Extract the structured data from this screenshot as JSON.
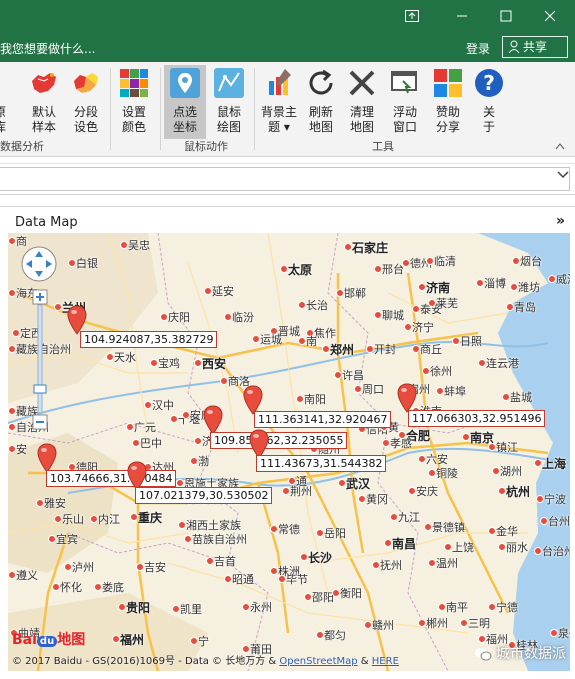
{
  "window": {
    "controls": [
      "ribbon-display-icon",
      "minimize-icon",
      "maximize-icon",
      "close-icon"
    ]
  },
  "tellbar": {
    "tell_text": "我您想要做什么...",
    "login": "登录",
    "share": "共享"
  },
  "ribbon": {
    "buttons": [
      {
        "label1": "数据分析",
        "label2": ""
      },
      {
        "label1": "默认",
        "label2": "样本"
      },
      {
        "label1": "分段",
        "label2": "设色"
      },
      {
        "label1": "设置",
        "label2": "颜色"
      },
      {
        "label1": "点选",
        "label2": "坐标"
      },
      {
        "label1": "鼠标",
        "label2": "绘图"
      },
      {
        "label1": "背景主",
        "label2": "题 ▾"
      },
      {
        "label1": "刷新",
        "label2": "地图"
      },
      {
        "label1": "清理",
        "label2": "地图"
      },
      {
        "label1": "浮动",
        "label2": "窗口"
      },
      {
        "label1": "赞助",
        "label2": "分享"
      },
      {
        "label1": "关",
        "label2": "于"
      }
    ],
    "groups": [
      "数据分析",
      "鼠标动作",
      "工具"
    ],
    "left_edge_chars": [
      "原",
      "库"
    ]
  },
  "panel": {
    "title": "Data Map",
    "expand_glyph": "»"
  },
  "map": {
    "cities": [
      [
        "吴忠",
        false
      ],
      [
        "太原",
        true
      ],
      [
        "石家庄",
        true
      ],
      [
        "德州",
        false
      ],
      [
        "烟台",
        false
      ],
      [
        "白银",
        false
      ],
      [
        "邢台",
        false
      ],
      [
        "临清",
        false
      ],
      [
        "威海",
        false
      ],
      [
        "海东",
        false
      ],
      [
        "兰州",
        true
      ],
      [
        "延安",
        false
      ],
      [
        "邯郸",
        false
      ],
      [
        "济南",
        true
      ],
      [
        "淄博",
        false
      ],
      [
        "潍坊",
        false
      ],
      [
        "庆阳",
        false
      ],
      [
        "长治",
        false
      ],
      [
        "临汾",
        false
      ],
      [
        "聊城",
        false
      ],
      [
        "泰安",
        false
      ],
      [
        "莱芜",
        false
      ],
      [
        "青岛",
        false
      ],
      [
        "定西",
        false
      ],
      [
        "晋城",
        false
      ],
      [
        "焦作",
        false
      ],
      [
        "运城",
        false
      ],
      [
        "济宁",
        false
      ],
      [
        "日照",
        false
      ],
      [
        "藏族自治州",
        false
      ],
      [
        "天水",
        false
      ],
      [
        "宝鸡",
        false
      ],
      [
        "西安",
        true
      ],
      [
        "郑州",
        true
      ],
      [
        "开封",
        false
      ],
      [
        "商丘",
        false
      ],
      [
        "徐州",
        false
      ],
      [
        "连云港",
        false
      ],
      [
        "商洛",
        false
      ],
      [
        "许昌",
        false
      ],
      [
        "周口",
        false
      ],
      [
        "宿州",
        false
      ],
      [
        "汉中",
        false
      ],
      [
        "十堰",
        false
      ],
      [
        "南阳",
        false
      ],
      [
        "驻马店",
        false
      ],
      [
        "蚌埠",
        false
      ],
      [
        "盐城",
        false
      ],
      [
        "藏族",
        false
      ],
      [
        "自治州",
        false
      ],
      [
        "广元",
        false
      ],
      [
        "安康",
        false
      ],
      [
        "信阳",
        false
      ],
      [
        "淮南",
        false
      ],
      [
        "合肥",
        true
      ],
      [
        "南京",
        true
      ],
      [
        "巴中",
        false
      ],
      [
        "达州",
        false
      ],
      [
        "随州",
        false
      ],
      [
        "孝感",
        false
      ],
      [
        "六安",
        false
      ],
      [
        "镇江",
        false
      ],
      [
        "德阳",
        false
      ],
      [
        "恩施土家族",
        false
      ],
      [
        "铜陵",
        false
      ],
      [
        "湖州",
        false
      ],
      [
        "上海",
        true
      ],
      [
        "雅安",
        false
      ],
      [
        "乐山",
        false
      ],
      [
        "内江",
        false
      ],
      [
        "重庆",
        true
      ],
      [
        "苗族自治州",
        false
      ],
      [
        "荆州",
        false
      ],
      [
        "武汉",
        true
      ],
      [
        "黄冈",
        false
      ],
      [
        "安庆",
        false
      ],
      [
        "杭州",
        true
      ],
      [
        "宁波",
        false
      ],
      [
        "宜宾",
        false
      ],
      [
        "泸州",
        false
      ],
      [
        "湘西土家族",
        false
      ],
      [
        "常德",
        false
      ],
      [
        "岳阳",
        false
      ],
      [
        "九江",
        false
      ],
      [
        "景德镇",
        false
      ],
      [
        "金华",
        false
      ],
      [
        "台州",
        false
      ],
      [
        "苗族自治州",
        false
      ],
      [
        "长沙",
        true
      ],
      [
        "南昌",
        true
      ],
      [
        "上饶",
        false
      ],
      [
        "丽水",
        false
      ],
      [
        "吉首",
        false
      ],
      [
        "株洲",
        false
      ],
      [
        "抚州",
        false
      ],
      [
        "温州",
        false
      ],
      [
        "台治州",
        false
      ],
      [
        "遵义",
        false
      ],
      [
        "怀化",
        false
      ],
      [
        "娄底",
        false
      ],
      [
        "吉安",
        false
      ],
      [
        "昭通",
        false
      ],
      [
        "毕节",
        false
      ],
      [
        "邵阳",
        false
      ],
      [
        "衡阳",
        false
      ],
      [
        "南平",
        false
      ],
      [
        "宁德",
        false
      ],
      [
        "贵阳",
        true
      ],
      [
        "凯里",
        false
      ],
      [
        "永州",
        false
      ],
      [
        "赣州",
        false
      ],
      [
        "福州",
        true
      ],
      [
        "曲靖",
        false
      ],
      [
        "宁",
        false
      ],
      [
        "都匀",
        false
      ],
      [
        "郴州",
        false
      ],
      [
        "三明",
        false
      ],
      [
        "福州",
        false
      ],
      [
        "莆田",
        false
      ],
      [
        "桂林",
        false
      ],
      [
        "泉州",
        false
      ],
      [
        "黄",
        false
      ],
      [
        "济宁",
        false
      ],
      [
        "安",
        false
      ],
      [
        "渤",
        false
      ],
      [
        "通",
        false
      ],
      [
        "南",
        false
      ],
      [
        "商",
        false
      ]
    ],
    "markers": [
      {
        "coord": "104.924087,35.382729"
      },
      {
        "coord": "111.363141,32.920467"
      },
      {
        "coord": "117.066303,32.951496"
      },
      {
        "coord": "109.854562,32.235055"
      },
      {
        "coord": "111.43673,31.544382"
      },
      {
        "coord": "103.74666,31.070484"
      },
      {
        "coord": "107.021379,30.530502"
      }
    ],
    "logo_text": "Bai",
    "logo_du": "du",
    "logo_suffix": "地图",
    "copyright": "© 2017 Baidu - GS(2016)1069号 - Data © 长地万方 &",
    "osm": "OpenStreetMap",
    "amp": "&",
    "here": "HERE",
    "watermark": "城市数据派",
    "sea_label": "黄"
  },
  "colors": {
    "excel_green": "#217346",
    "marker_red": "#e74c3c",
    "label_border": "#c0392b",
    "map_land": "#f6f0e0",
    "map_sea": "#a9d1ef"
  }
}
